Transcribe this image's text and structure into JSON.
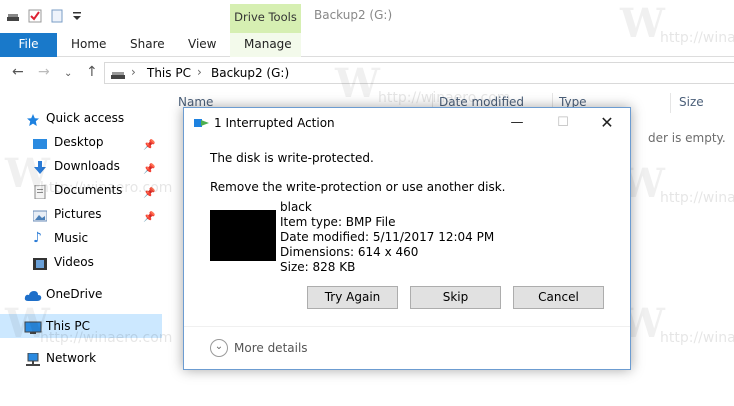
{
  "title": {
    "context_tab": "Drive Tools",
    "window_title": "Backup2 (G:)"
  },
  "ribbon": {
    "tabs": [
      "File",
      "Home",
      "Share",
      "View",
      "Manage"
    ]
  },
  "address": {
    "path": [
      "This PC",
      "Backup2 (G:)"
    ]
  },
  "sidebar": {
    "items": [
      {
        "label": "Quick access",
        "icon": "star-icon"
      },
      {
        "label": "Desktop",
        "icon": "desktop-icon",
        "pinned": true
      },
      {
        "label": "Downloads",
        "icon": "download-icon",
        "pinned": true
      },
      {
        "label": "Documents",
        "icon": "documents-icon",
        "pinned": true
      },
      {
        "label": "Pictures",
        "icon": "pictures-icon",
        "pinned": true
      },
      {
        "label": "Music",
        "icon": "music-icon"
      },
      {
        "label": "Videos",
        "icon": "videos-icon"
      },
      {
        "label": "OneDrive",
        "icon": "cloud-icon"
      },
      {
        "label": "This PC",
        "icon": "computer-icon",
        "selected": true
      },
      {
        "label": "Network",
        "icon": "network-icon"
      }
    ]
  },
  "content": {
    "columns": [
      "Name",
      "Date modified",
      "Type",
      "Size"
    ],
    "empty_text": "der is empty."
  },
  "watermark": {
    "text": "http://winaero.com",
    "logo": "W"
  },
  "dialog": {
    "title": "1 Interrupted Action",
    "message": "The disk is write-protected.",
    "instruction": "Remove the write-protection or use another disk.",
    "file": {
      "name": "black",
      "type": "Item type: BMP File",
      "modified": "Date modified: 5/11/2017 12:04 PM",
      "dimensions": "Dimensions: 614 x 460",
      "size": "Size: 828 KB"
    },
    "buttons": {
      "retry": "Try Again",
      "skip": "Skip",
      "cancel": "Cancel"
    },
    "more_details": "More details"
  },
  "colors": {
    "accent": "#1979ca",
    "context_tab": "#d6efb2",
    "selection": "#cce8ff"
  }
}
